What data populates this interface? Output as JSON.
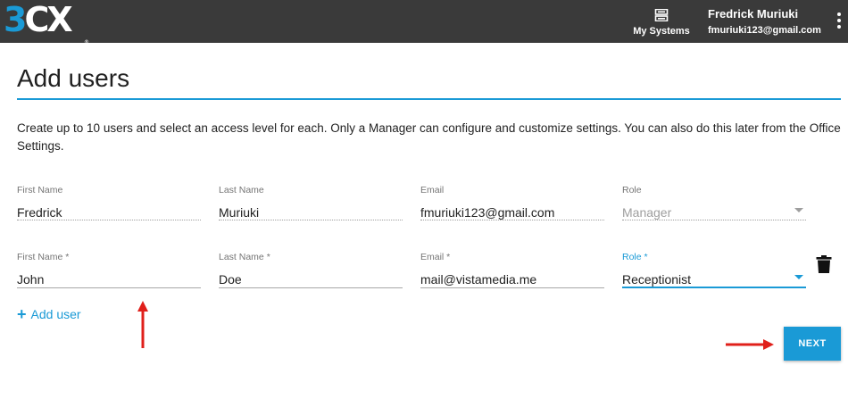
{
  "header": {
    "logo": {
      "part1": "3",
      "part2": "CX",
      "tm": "®"
    },
    "my_systems_label": "My Systems",
    "my_systems_icon": "server-icon",
    "user_name": "Fredrick Muriuki",
    "user_email": "fmuriuki123@gmail.com",
    "menu_icon": "kebab-menu-icon"
  },
  "page": {
    "title": "Add users",
    "description": "Create up to 10 users and select an access level for each. Only a Manager can configure and customize settings. You can also do this later from the Office Settings."
  },
  "users": [
    {
      "first_name_label": "First Name",
      "first_name": "Fredrick",
      "last_name_label": "Last Name",
      "last_name": "Muriuki",
      "email_label": "Email",
      "email": "fmuriuki123@gmail.com",
      "role_label": "Role",
      "role": "Manager"
    },
    {
      "first_name_label": "First Name *",
      "first_name": "John",
      "last_name_label": "Last Name *",
      "last_name": "Doe",
      "email_label": "Email *",
      "email": "mail@vistamedia.me",
      "role_label": "Role *",
      "role": "Receptionist"
    }
  ],
  "actions": {
    "add_user_icon": "plus-icon",
    "add_user_label": "Add user",
    "next_label": "NEXT",
    "delete_icon": "trash-icon"
  },
  "colors": {
    "accent": "#1a9ad6",
    "topbar": "#3a3a3a",
    "annotation": "#e0201b"
  }
}
